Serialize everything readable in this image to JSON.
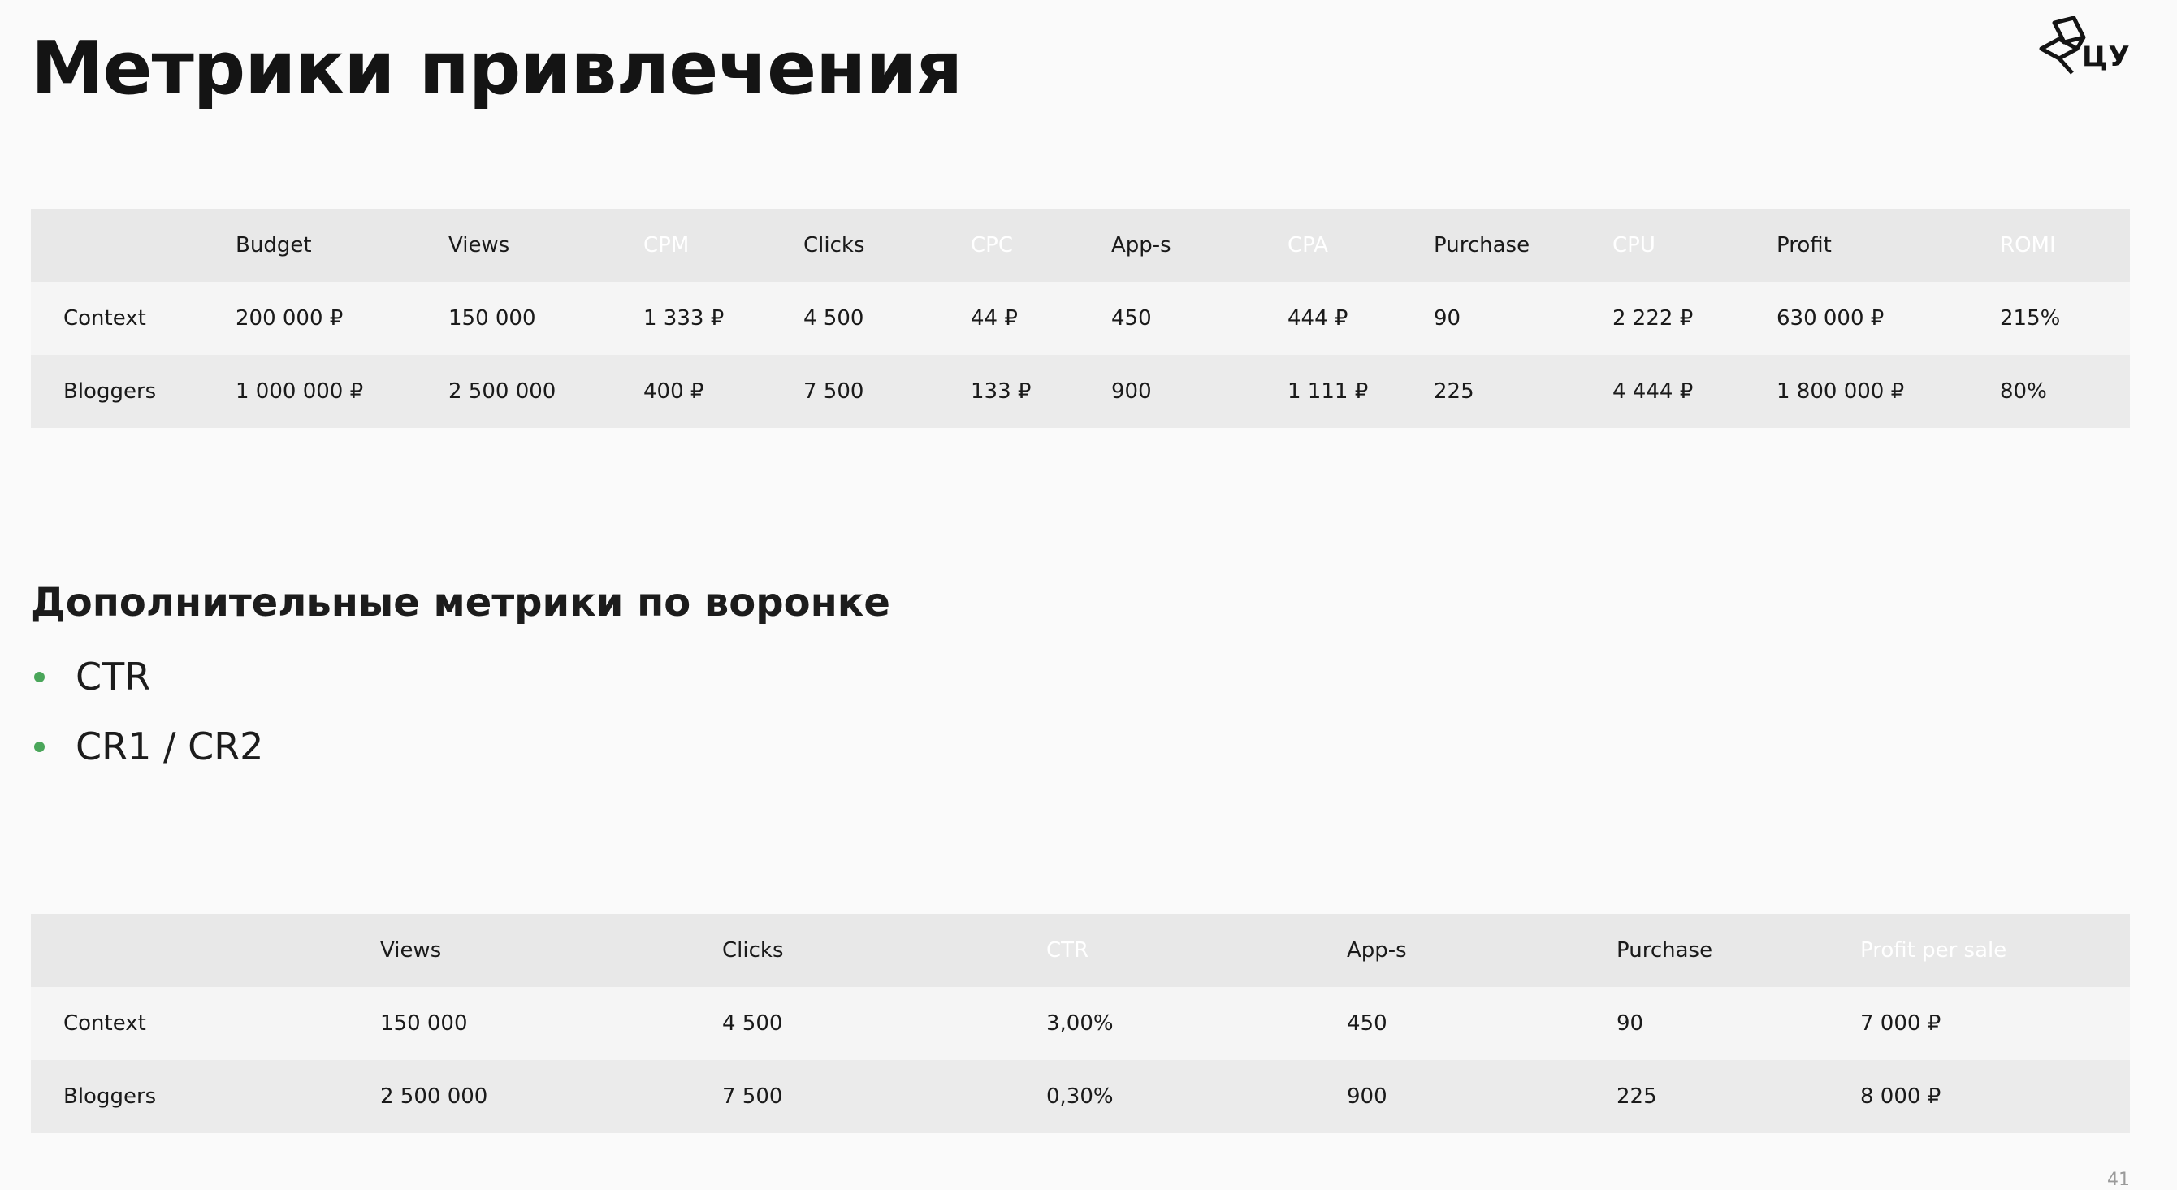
{
  "title": "Метрики привлечения",
  "logo": {
    "text": "ЦУ"
  },
  "table1": {
    "headers": [
      "",
      "Budget",
      "Views",
      "CPM",
      "Clicks",
      "CPC",
      "App-s",
      "CPA",
      "Purchase",
      "CPU",
      "Profit",
      "ROMI"
    ],
    "header_highlights": [
      "none",
      "none",
      "none",
      "pink",
      "none",
      "pink",
      "none",
      "green",
      "none",
      "green",
      "none",
      "green"
    ],
    "rows": [
      [
        "Context",
        "200 000 ₽",
        "150 000",
        "1 333 ₽",
        "4 500",
        "44 ₽",
        "450",
        "444 ₽",
        "90",
        "2 222 ₽",
        "630 000 ₽",
        "215%"
      ],
      [
        "Bloggers",
        "1 000 000 ₽",
        "2 500 000",
        "400 ₽",
        "7 500",
        "133 ₽",
        "900",
        "1 111 ₽",
        "225",
        "4 444 ₽",
        "1 800 000 ₽",
        "80%"
      ]
    ]
  },
  "subtitle": "Дополнительные метрики по воронке",
  "bullets": [
    "CTR",
    "CR1 / CR2"
  ],
  "table2": {
    "headers": [
      "",
      "Views",
      "Clicks",
      "CTR",
      "App-s",
      "Purchase",
      "Profit per sale"
    ],
    "header_highlights": [
      "none",
      "none",
      "none",
      "green",
      "none",
      "none",
      "green"
    ],
    "rows": [
      [
        "Context",
        "150 000",
        "4 500",
        "3,00%",
        "450",
        "90",
        "7 000 ₽"
      ],
      [
        "Bloggers",
        "2 500 000",
        "7 500",
        "0,30%",
        "900",
        "225",
        "8 000 ₽"
      ]
    ]
  },
  "page_number": "41",
  "colors": {
    "pink": "#f075b8",
    "green": "#4aa65a",
    "header_bg": "#e8e8e8"
  }
}
